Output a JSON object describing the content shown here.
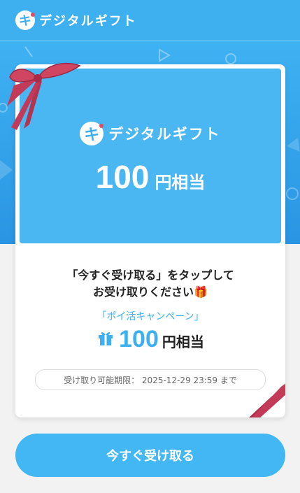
{
  "header": {
    "logo_mark": "キ",
    "logo_text": "デジタルギフト"
  },
  "card": {
    "logo_mark": "キ",
    "logo_text": "デジタルギフト",
    "amount": "100",
    "unit": "円相当"
  },
  "message": {
    "line1": "「今すぐ受け取る」をタップして",
    "line2": "お受け取りください🎁"
  },
  "campaign": "「ポイ活キャンペーン」",
  "amount": {
    "value": "100",
    "unit": "円相当"
  },
  "expiry": "受け取り可能期限： 2025-12-29 23:59 まで",
  "cta_label": "今すぐ受け取る",
  "colors": {
    "brand": "#3eb0f0",
    "ribbon": "#c23a58",
    "accent_dot": "#e24b63"
  },
  "icons": [
    "gift-icon",
    "ribbon-icon"
  ]
}
